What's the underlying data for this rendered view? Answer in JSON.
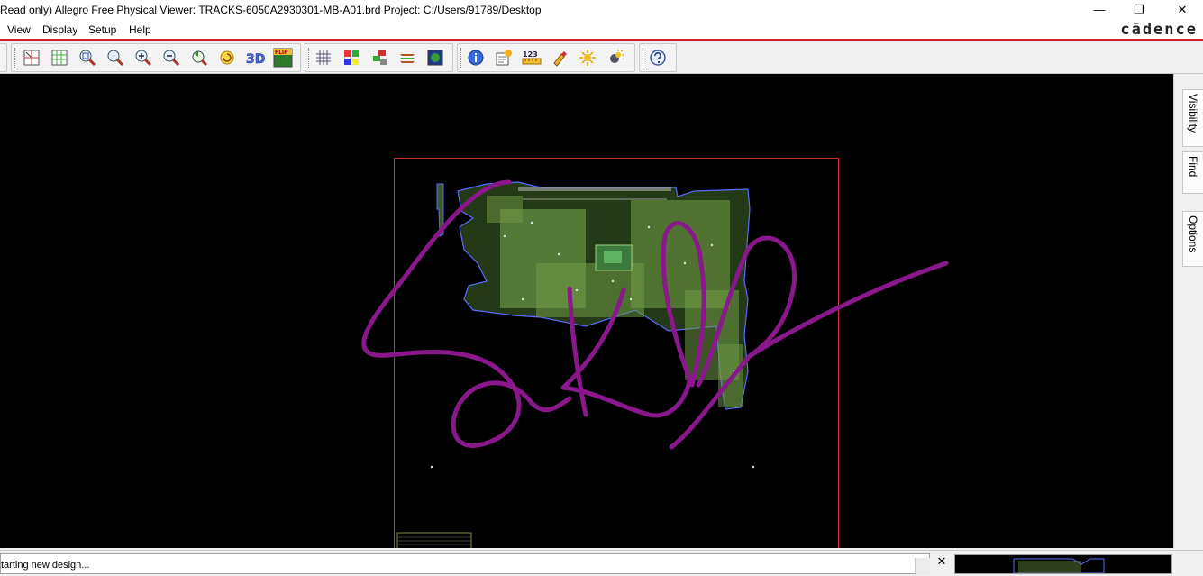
{
  "window": {
    "title": "Read only) Allegro Free Physical Viewer: TRACKS-6050A2930301-MB-A01.brd  Project: C:/Users/91789/Desktop",
    "minimize_glyph": "—",
    "restore_glyph": "❐",
    "close_glyph": "✕"
  },
  "menu": {
    "items": [
      {
        "label": "View"
      },
      {
        "label": "Display"
      },
      {
        "label": "Setup"
      },
      {
        "label": "Help"
      }
    ],
    "brand": "cādence"
  },
  "toolbar": {
    "icons": [
      "zoom-fit-icon",
      "zoom-grid-icon",
      "zoom-window-icon",
      "zoom-points-icon",
      "zoom-in-icon",
      "zoom-out-icon",
      "zoom-previous-icon",
      "redraw-icon",
      "3d-view-icon",
      "flip-icon",
      "grid-icon",
      "color-icon",
      "layers-icon",
      "stackup-icon",
      "world-view-icon",
      "info-icon",
      "show-element-icon",
      "measure-icon",
      "highlight-icon",
      "dehighlight-icon",
      "shadow-icon",
      "help-icon"
    ],
    "labels": {
      "three_d": "3D",
      "flip": "FLIP",
      "measure": "123"
    }
  },
  "sidebar": {
    "tabs": [
      {
        "label": "Visibility"
      },
      {
        "label": "Find"
      },
      {
        "label": "Options"
      }
    ]
  },
  "status": {
    "message": "tarting new design...",
    "close_glyph": "✕"
  },
  "colors": {
    "canvas_bg": "#000000",
    "board_outline": "#d03030",
    "pcb_edge": "#5a6cff",
    "pcb_fill": "#6f9a45",
    "signature": "#8a178c",
    "accent_red": "#d0202a"
  }
}
